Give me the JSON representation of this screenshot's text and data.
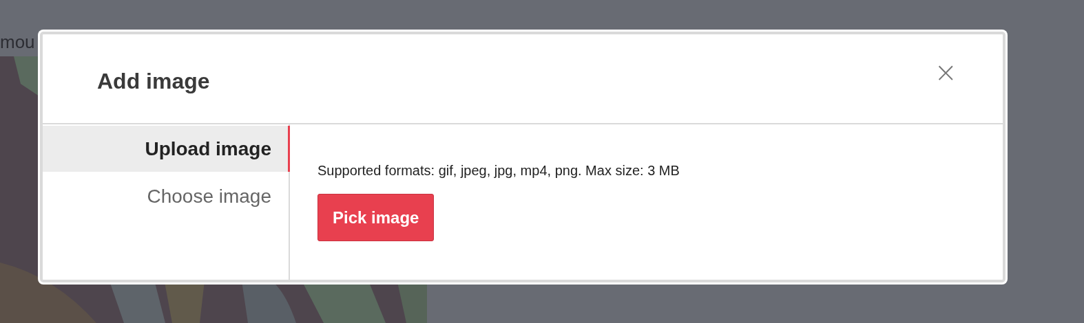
{
  "background": {
    "text": "mou"
  },
  "dialog": {
    "title": "Add image",
    "close": "×",
    "tabs": [
      {
        "label": "Upload image",
        "selected": true
      },
      {
        "label": "Choose image",
        "selected": false
      }
    ],
    "formats": "Supported formats: gif, jpeg, jpg, mp4, png. Max size: 3 MB",
    "button": "Pick image"
  }
}
